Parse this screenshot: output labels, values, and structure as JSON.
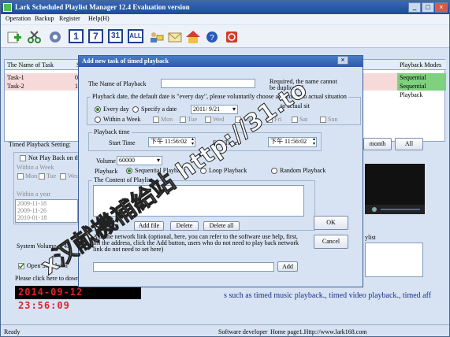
{
  "window": {
    "title": "Lark Scheduled Playlist Manager 12.4 Evaluation version",
    "min": "_",
    "max": "□",
    "close": "×"
  },
  "menu": [
    "Operation",
    "Backup",
    "Register",
    "Help(H)"
  ],
  "toolbar": {
    "num1": "1",
    "num7": "7",
    "num31": "31",
    "all": "ALL"
  },
  "grid": {
    "headers": [
      "The Name of Task",
      "St",
      "Playback Modes"
    ],
    "rows": [
      {
        "name": "Task-1",
        "col": "09",
        "mode": "Sequential Playback"
      },
      {
        "name": "Task-2",
        "col": "10",
        "mode": "Sequential Playback"
      }
    ]
  },
  "left": {
    "timed_setting": "Timed Playback Setting:",
    "not_play": "Not Play Back on the",
    "within_week": "Within a Week",
    "mon": "Mon",
    "tue": "Tue",
    "wed": "Wed",
    "within_year": "Within a year",
    "dates": [
      "2009-11-18",
      "2009-11-26",
      "2010-01-18"
    ],
    "dates_right": [
      "20",
      "20",
      ""
    ],
    "system_volume": "System Volume",
    "volume_num": "45",
    "open_shutdown": "Open Shutdown",
    "click_here": "Please click here to download",
    "clock": "2014-09-12 23:56:09"
  },
  "right": {
    "month": "month",
    "all": "All",
    "playlist": "ylist"
  },
  "marquee": "s such as timed music playback., timed video playback., timed aff",
  "status": {
    "ready": "Ready",
    "developer": "Software developer",
    "home": "Home page1.Http://www.lark168.com"
  },
  "dialog": {
    "title": "Add new task of timed playback",
    "name_label": "The Name of Playback",
    "name_value": "",
    "required": "Required, the name cannot be duplicated",
    "date_group": "Playback date, the default date is \"every day\", please voluntarily choose according to actual situation",
    "every_day": "Every day",
    "specify_date": "Specify a date",
    "date_value": "2011/ 9/21",
    "to_actual": "to actual sit",
    "within_week": "Within a Week",
    "days": [
      "Mon",
      "Tue",
      "Wed",
      "Thu",
      "Fri",
      "Sat",
      "Sun"
    ],
    "time_group": "Playback time",
    "start_label": "Start Time",
    "start_value": "下午 11:56:02",
    "end_label": "End Time",
    "end_value": "下午 11:56:02",
    "volume_label": "Volume",
    "volume_value": "60000",
    "playback_label": "Playback",
    "sequential": "Sequential Playback",
    "loop": "Loop Playback",
    "random": "Random Playback",
    "content_group": "The Content of Playlist",
    "add_file": "Add file",
    "delete": "Delete",
    "delete_all": "Delete all",
    "note_label": "Add",
    "note": "Add the network link (optional, here, you can refer to the software use help, first, fill the address, click the Add button, users who do not need to play back network link do not need to set here)",
    "link_value": "",
    "add": "Add",
    "ok": "OK",
    "cancel": "Cancel"
  },
  "watermark": "x汉献機補給站 http://31.to"
}
